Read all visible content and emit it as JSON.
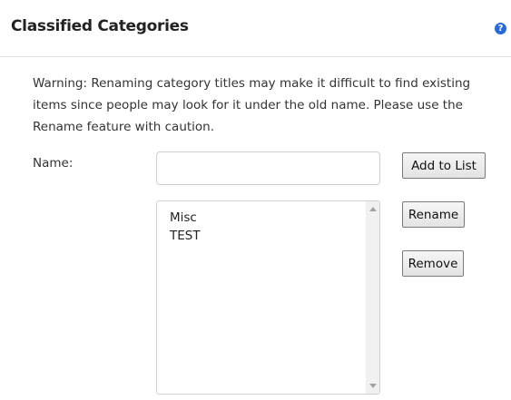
{
  "header": {
    "title": "Classified Categories",
    "help_icon_glyph": "?"
  },
  "warning": {
    "text": "Warning: Renaming category titles may make it difficult to find existing items since people may look for it under the old name. Please use the Rename feature with caution."
  },
  "form": {
    "name_label": "Name:",
    "name_value": "",
    "name_placeholder": ""
  },
  "buttons": {
    "add_label": "Add to List",
    "rename_label": "Rename",
    "remove_label": "Remove"
  },
  "categories": {
    "items": [
      "Misc",
      "TEST"
    ]
  },
  "colors": {
    "help_icon": "#2a6bd1",
    "divider": "#e2e2e2"
  },
  "icons": {
    "help": "help-icon",
    "scroll_up": "scroll-up-arrow-icon",
    "scroll_down": "scroll-down-arrow-icon"
  }
}
